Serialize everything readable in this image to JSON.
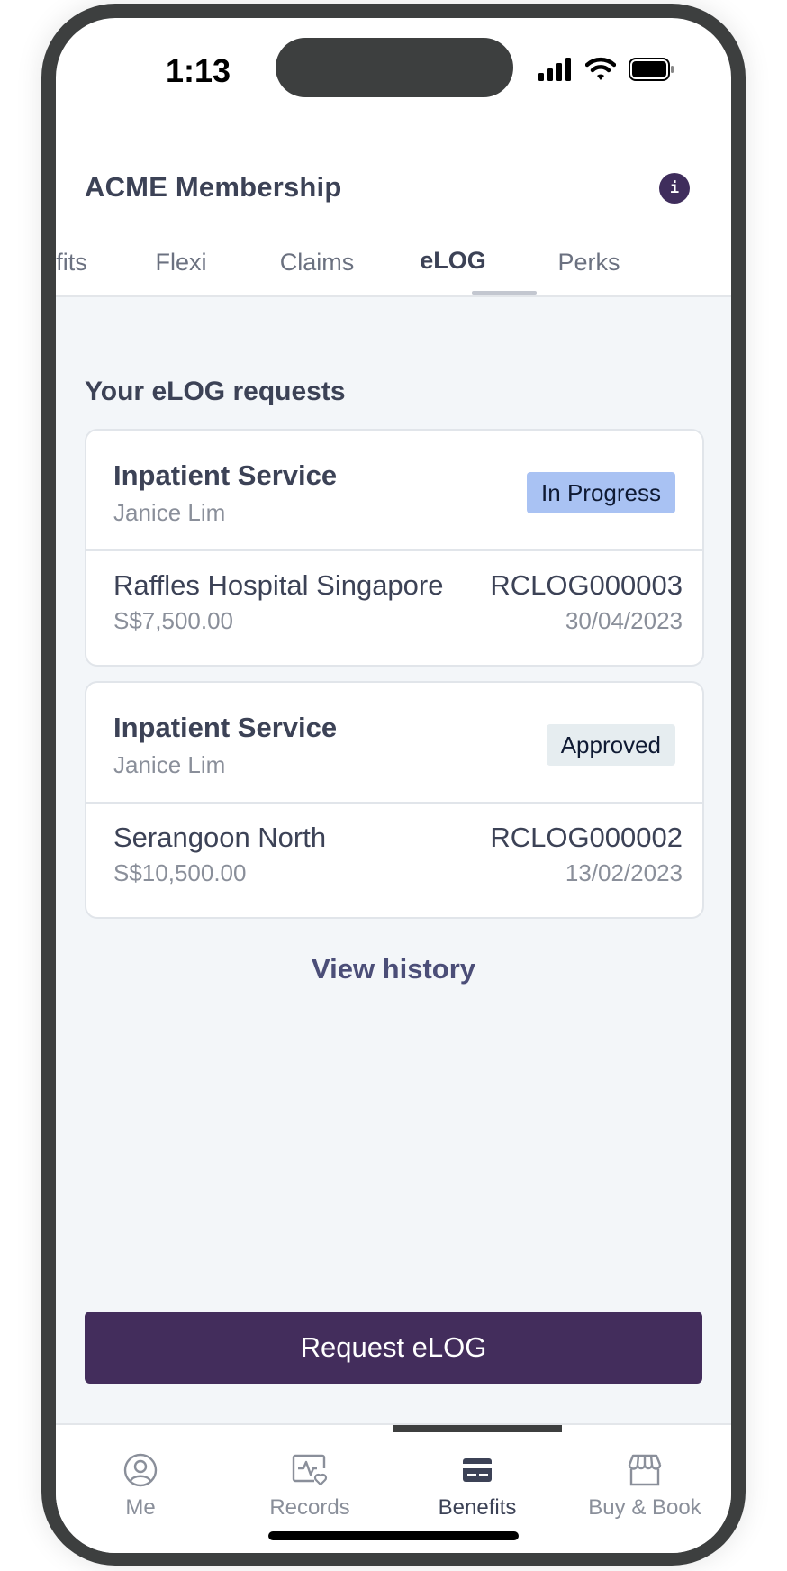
{
  "status_bar": {
    "time": "1:13"
  },
  "header": {
    "title": "ACME Membership",
    "info_icon": "i"
  },
  "tabs": [
    {
      "label": "efits",
      "active": false
    },
    {
      "label": "Flexi",
      "active": false
    },
    {
      "label": "Claims",
      "active": false
    },
    {
      "label": "eLOG",
      "active": true
    },
    {
      "label": "Perks",
      "active": false
    }
  ],
  "main": {
    "section_title": "Your eLOG requests",
    "requests": [
      {
        "service": "Inpatient Service",
        "patient": "Janice Lim",
        "status": "In Progress",
        "provider": "Raffles Hospital Singapore",
        "amount": "S$7,500.00",
        "reference": "RCLOG000003",
        "date": "30/04/2023"
      },
      {
        "service": "Inpatient Service",
        "patient": "Janice Lim",
        "status": "Approved",
        "provider": "Serangoon North",
        "amount": "S$10,500.00",
        "reference": "RCLOG000002",
        "date": "13/02/2023"
      }
    ],
    "view_history": "View history",
    "request_button": "Request eLOG"
  },
  "bottom_nav": [
    {
      "label": "Me",
      "icon": "user-icon",
      "active": false
    },
    {
      "label": "Records",
      "icon": "health-records-icon",
      "active": false
    },
    {
      "label": "Benefits",
      "icon": "card-icon",
      "active": true
    },
    {
      "label": "Buy & Book",
      "icon": "store-icon",
      "active": false
    }
  ],
  "colors": {
    "primary": "#432d5c",
    "text": "#3c4256",
    "muted": "#8a8f9a",
    "background": "#f3f6f9",
    "badge_in_progress": "#a9c2f3",
    "badge_approved": "#e6edf0"
  }
}
